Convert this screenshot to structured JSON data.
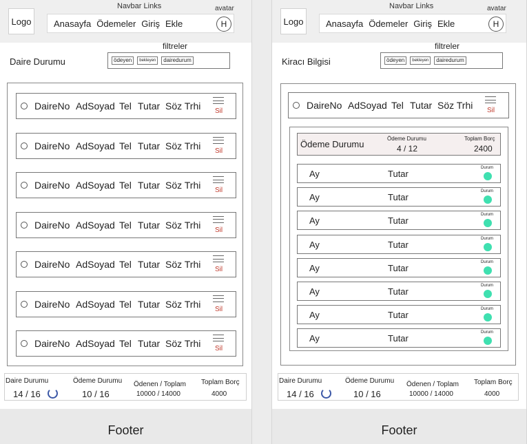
{
  "left": {
    "header": {
      "logo": "Logo",
      "navbar_title": "Navbar Links",
      "nav": [
        "Anasayfa",
        "Ödemeler",
        "Giriş",
        "Ekle"
      ],
      "avatar_label": "avatar",
      "avatar_initial": "H"
    },
    "section_title": "Daire Durumu",
    "filters": {
      "title": "filtreler",
      "chips": [
        "ödeyen",
        "bekleyen",
        "dairedurum"
      ]
    },
    "rows": {
      "columns": [
        "DaireNo",
        "AdSoyad",
        "Tel",
        "Tutar",
        "Söz Trhi"
      ],
      "delete_label": "Sil",
      "count": 7
    },
    "summary": {
      "daire_label": "Daire Durumu",
      "daire_value": "14 / 16",
      "odeme_label": "Ödeme Durumu",
      "odeme_value": "10 / 16",
      "odenen_label": "Ödenen / Toplam",
      "odenen_value": "10000 / 14000",
      "borc_label": "Toplam Borç",
      "borc_value": "4000"
    },
    "footer": "Footer"
  },
  "right": {
    "header": {
      "logo": "Logo",
      "navbar_title": "Navbar Links",
      "nav": [
        "Anasayfa",
        "Ödemeler",
        "Giriş",
        "Ekle"
      ],
      "avatar_label": "avatar",
      "avatar_initial": "H"
    },
    "section_title": "Kiracı Bilgisi",
    "filters": {
      "title": "filtreler",
      "chips": [
        "ödeyen",
        "bekleyen",
        "dairedurum"
      ]
    },
    "tenant": {
      "columns": [
        "DaireNo",
        "AdSoyad",
        "Tel",
        "Tutar",
        "Söz Trhi"
      ],
      "delete_label": "Sil"
    },
    "payment": {
      "title": "Ödeme Durumu",
      "status_label": "Ödeme Durumu",
      "status_value": "4 / 12",
      "debt_label": "Toplam Borç",
      "debt_value": "2400",
      "month_label": "Ay",
      "amount_label": "Tutar",
      "status_small": "Durum",
      "status_color": "#3fe0b0",
      "month_count": 8
    },
    "summary": {
      "daire_label": "Daire Durumu",
      "daire_value": "14 / 16",
      "odeme_label": "Ödeme Durumu",
      "odeme_value": "10 / 16",
      "odenen_label": "Ödenen / Toplam",
      "odenen_value": "10000 / 14000",
      "borc_label": "Toplam Borç",
      "borc_value": "4000"
    },
    "footer": "Footer"
  }
}
